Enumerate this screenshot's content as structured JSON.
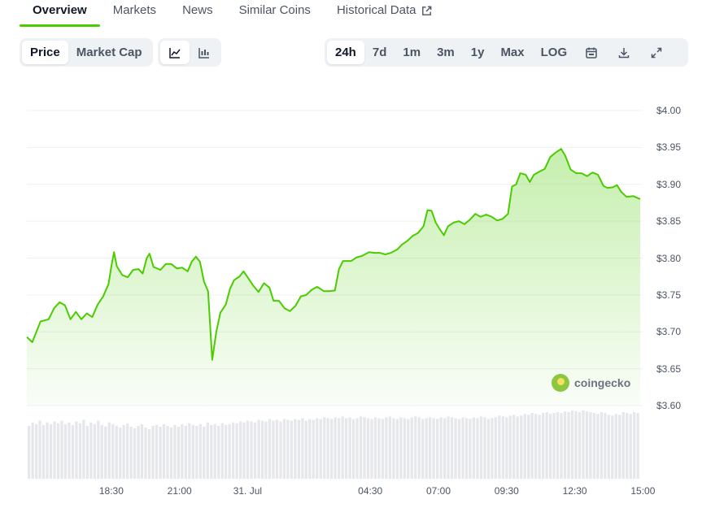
{
  "tabs": [
    {
      "label": "Overview"
    },
    {
      "label": "Markets"
    },
    {
      "label": "News"
    },
    {
      "label": "Similar Coins"
    },
    {
      "label": "Historical Data"
    }
  ],
  "controls": {
    "type_options": [
      "Price",
      "Market Cap"
    ],
    "selected_type": "Price",
    "chart_style_icons": [
      "line-chart-icon",
      "candlestick-chart-icon"
    ],
    "selected_style": "line-chart-icon",
    "ranges": [
      "24h",
      "7d",
      "1m",
      "3m",
      "1y",
      "Max",
      "LOG"
    ],
    "selected_range": "24h",
    "tool_icons": [
      "calendar-icon",
      "download-icon",
      "expand-icon"
    ]
  },
  "watermark": "coingecko",
  "colors": {
    "line": "#4bcc00",
    "fill": "#4bcc00",
    "accent": "#4bcc00",
    "grid": "#eef0f3",
    "volume": "#e5e7eb"
  },
  "chart_data": {
    "type": "area",
    "y_axis_labels": [
      "$4.00",
      "$3.95",
      "$3.90",
      "$3.85",
      "$3.80",
      "$3.75",
      "$3.70",
      "$3.65",
      "$3.60"
    ],
    "ylim": [
      3.6,
      4.0
    ],
    "x_axis_labels": [
      {
        "label": "18:30",
        "t": 3.0
      },
      {
        "label": "21:00",
        "t": 5.5
      },
      {
        "label": "31. Jul",
        "t": 8.0
      },
      {
        "label": "04:30",
        "t": 12.5
      },
      {
        "label": "07:00",
        "t": 15.0
      },
      {
        "label": "09:30",
        "t": 17.5
      },
      {
        "label": "12:30",
        "t": 20.0
      },
      {
        "label": "15:00",
        "t": 22.5
      }
    ],
    "t_range": [
      -0.1,
      22.4
    ],
    "series": [
      {
        "values": [
          [
            -0.1,
            3.693
          ],
          [
            0.1,
            3.686
          ],
          [
            0.4,
            3.714
          ],
          [
            0.7,
            3.717
          ],
          [
            0.9,
            3.732
          ],
          [
            1.1,
            3.74
          ],
          [
            1.3,
            3.736
          ],
          [
            1.5,
            3.717
          ],
          [
            1.7,
            3.727
          ],
          [
            1.9,
            3.717
          ],
          [
            2.1,
            3.725
          ],
          [
            2.3,
            3.72
          ],
          [
            2.5,
            3.737
          ],
          [
            2.7,
            3.748
          ],
          [
            2.9,
            3.765
          ],
          [
            3.0,
            3.789
          ],
          [
            3.1,
            3.808
          ],
          [
            3.2,
            3.789
          ],
          [
            3.4,
            3.777
          ],
          [
            3.6,
            3.774
          ],
          [
            3.8,
            3.784
          ],
          [
            4.0,
            3.785
          ],
          [
            4.15,
            3.779
          ],
          [
            4.3,
            3.8
          ],
          [
            4.4,
            3.806
          ],
          [
            4.55,
            3.788
          ],
          [
            4.8,
            3.784
          ],
          [
            5.0,
            3.792
          ],
          [
            5.2,
            3.792
          ],
          [
            5.4,
            3.786
          ],
          [
            5.6,
            3.787
          ],
          [
            5.8,
            3.782
          ],
          [
            5.95,
            3.795
          ],
          [
            6.1,
            3.802
          ],
          [
            6.25,
            3.795
          ],
          [
            6.4,
            3.768
          ],
          [
            6.55,
            3.755
          ],
          [
            6.7,
            3.662
          ],
          [
            6.85,
            3.7
          ],
          [
            7.0,
            3.726
          ],
          [
            7.2,
            3.737
          ],
          [
            7.35,
            3.758
          ],
          [
            7.5,
            3.77
          ],
          [
            7.7,
            3.775
          ],
          [
            7.85,
            3.782
          ],
          [
            8.0,
            3.774
          ],
          [
            8.2,
            3.763
          ],
          [
            8.4,
            3.754
          ],
          [
            8.6,
            3.766
          ],
          [
            8.8,
            3.76
          ],
          [
            8.95,
            3.742
          ],
          [
            9.15,
            3.742
          ],
          [
            9.35,
            3.732
          ],
          [
            9.55,
            3.728
          ],
          [
            9.75,
            3.735
          ],
          [
            9.95,
            3.748
          ],
          [
            10.15,
            3.75
          ],
          [
            10.35,
            3.757
          ],
          [
            10.55,
            3.761
          ],
          [
            10.8,
            3.755
          ],
          [
            11.0,
            3.755
          ],
          [
            11.2,
            3.756
          ],
          [
            11.35,
            3.785
          ],
          [
            11.5,
            3.796
          ],
          [
            11.8,
            3.796
          ],
          [
            12.0,
            3.801
          ],
          [
            12.2,
            3.803
          ],
          [
            12.45,
            3.808
          ],
          [
            12.65,
            3.807
          ],
          [
            12.85,
            3.807
          ],
          [
            13.05,
            3.805
          ],
          [
            13.25,
            3.807
          ],
          [
            13.5,
            3.812
          ],
          [
            13.65,
            3.818
          ],
          [
            13.85,
            3.823
          ],
          [
            14.05,
            3.83
          ],
          [
            14.25,
            3.834
          ],
          [
            14.45,
            3.843
          ],
          [
            14.6,
            3.865
          ],
          [
            14.75,
            3.864
          ],
          [
            14.9,
            3.848
          ],
          [
            15.05,
            3.839
          ],
          [
            15.2,
            3.831
          ],
          [
            15.35,
            3.843
          ],
          [
            15.55,
            3.848
          ],
          [
            15.75,
            3.85
          ],
          [
            15.95,
            3.846
          ],
          [
            16.15,
            3.852
          ],
          [
            16.35,
            3.86
          ],
          [
            16.55,
            3.856
          ],
          [
            16.75,
            3.859
          ],
          [
            16.95,
            3.856
          ],
          [
            17.15,
            3.851
          ],
          [
            17.35,
            3.853
          ],
          [
            17.55,
            3.86
          ],
          [
            17.7,
            3.897
          ],
          [
            17.85,
            3.9
          ],
          [
            18.0,
            3.915
          ],
          [
            18.2,
            3.913
          ],
          [
            18.35,
            3.903
          ],
          [
            18.5,
            3.913
          ],
          [
            18.7,
            3.917
          ],
          [
            18.9,
            3.921
          ],
          [
            19.1,
            3.937
          ],
          [
            19.3,
            3.943
          ],
          [
            19.5,
            3.948
          ],
          [
            19.65,
            3.939
          ],
          [
            19.85,
            3.92
          ],
          [
            20.05,
            3.915
          ],
          [
            20.25,
            3.915
          ],
          [
            20.45,
            3.911
          ],
          [
            20.65,
            3.916
          ],
          [
            20.85,
            3.913
          ],
          [
            21.05,
            3.898
          ],
          [
            21.2,
            3.895
          ],
          [
            21.4,
            3.896
          ],
          [
            21.55,
            3.899
          ],
          [
            21.7,
            3.89
          ],
          [
            21.9,
            3.883
          ],
          [
            22.15,
            3.884
          ],
          [
            22.4,
            3.88
          ]
        ]
      }
    ],
    "volume": [
      0.62,
      0.66,
      0.64,
      0.68,
      0.63,
      0.66,
      0.64,
      0.67,
      0.65,
      0.68,
      0.64,
      0.66,
      0.63,
      0.67,
      0.65,
      0.69,
      0.62,
      0.66,
      0.64,
      0.68,
      0.63,
      0.61,
      0.66,
      0.64,
      0.62,
      0.6,
      0.63,
      0.65,
      0.61,
      0.59,
      0.62,
      0.64,
      0.6,
      0.58,
      0.62,
      0.63,
      0.61,
      0.64,
      0.62,
      0.6,
      0.63,
      0.61,
      0.64,
      0.62,
      0.65,
      0.63,
      0.62,
      0.64,
      0.61,
      0.66,
      0.63,
      0.64,
      0.62,
      0.65,
      0.63,
      0.64,
      0.66,
      0.65,
      0.67,
      0.66,
      0.68,
      0.67,
      0.66,
      0.69,
      0.68,
      0.67,
      0.7,
      0.68,
      0.69,
      0.67,
      0.7,
      0.69,
      0.68,
      0.7,
      0.69,
      0.71,
      0.68,
      0.7,
      0.69,
      0.71,
      0.7,
      0.72,
      0.71,
      0.7,
      0.72,
      0.71,
      0.73,
      0.71,
      0.72,
      0.7,
      0.71,
      0.73,
      0.72,
      0.71,
      0.7,
      0.72,
      0.71,
      0.7,
      0.72,
      0.73,
      0.71,
      0.7,
      0.72,
      0.71,
      0.7,
      0.72,
      0.73,
      0.72,
      0.7,
      0.71,
      0.72,
      0.71,
      0.7,
      0.72,
      0.71,
      0.73,
      0.72,
      0.71,
      0.7,
      0.72,
      0.71,
      0.7,
      0.72,
      0.71,
      0.73,
      0.72,
      0.7,
      0.71,
      0.72,
      0.74,
      0.73,
      0.72,
      0.74,
      0.75,
      0.73,
      0.74,
      0.76,
      0.75,
      0.77,
      0.76,
      0.75,
      0.77,
      0.78,
      0.76,
      0.77,
      0.78,
      0.77,
      0.79,
      0.78,
      0.8,
      0.79,
      0.78,
      0.8,
      0.79,
      0.78,
      0.77,
      0.76,
      0.78,
      0.77,
      0.75,
      0.74,
      0.76,
      0.75,
      0.78,
      0.77,
      0.76,
      0.78,
      0.77
    ]
  }
}
